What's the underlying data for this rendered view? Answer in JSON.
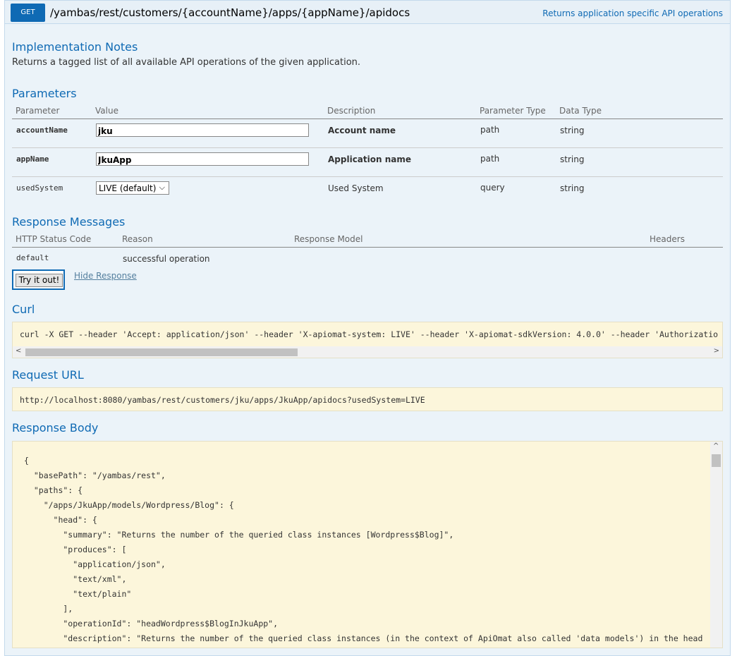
{
  "operation": {
    "method": "GET",
    "path": "/yambas/rest/customers/{accountName}/apps/{appName}/apidocs",
    "summary": "Returns application specific API operations"
  },
  "implementation": {
    "heading": "Implementation Notes",
    "text": "Returns a tagged list of all available API operations of the given application."
  },
  "parameters": {
    "heading": "Parameters",
    "columns": [
      "Parameter",
      "Value",
      "Description",
      "Parameter Type",
      "Data Type"
    ],
    "rows": [
      {
        "name": "accountName",
        "value": "jku",
        "description": "Account name",
        "type": "path",
        "data_type": "string"
      },
      {
        "name": "appName",
        "value": "JkuApp",
        "description": "Application name",
        "type": "path",
        "data_type": "string"
      },
      {
        "name": "usedSystem",
        "value": "LIVE (default)",
        "description": "Used System",
        "type": "query",
        "data_type": "string"
      }
    ]
  },
  "responses": {
    "heading": "Response Messages",
    "columns": [
      "HTTP Status Code",
      "Reason",
      "Response Model",
      "Headers"
    ],
    "rows": [
      {
        "code": "default",
        "reason": "successful operation"
      }
    ]
  },
  "actions": {
    "try_label": "Try it out!",
    "hide_label": "Hide Response"
  },
  "curl": {
    "heading": "Curl",
    "command": "curl -X GET --header 'Accept: application/json' --header 'X-apiomat-system: LIVE' --header 'X-apiomat-sdkVersion: 4.0.0' --header 'Authorizatio"
  },
  "request_url": {
    "heading": "Request URL",
    "url": "http://localhost:8080/yambas/rest/customers/jku/apps/JkuApp/apidocs?usedSystem=LIVE"
  },
  "response_body": {
    "heading": "Response Body",
    "lines": [
      "{",
      "  \"basePath\": \"/yambas/rest\",",
      "  \"paths\": {",
      "    \"/apps/JkuApp/models/Wordpress/Blog\": {",
      "      \"head\": {",
      "        \"summary\": \"Returns the number of the queried class instances [Wordpress$Blog]\",",
      "        \"produces\": [",
      "          \"application/json\",",
      "          \"text/xml\",",
      "          \"text/plain\"",
      "        ],",
      "        \"operationId\": \"headWordpress$BlogInJkuApp\",",
      "        \"description\": \"Returns the number of the queried class instances (in the context of ApiOmat also called 'data models') in the head"
    ]
  },
  "icons": {
    "chevron_down": "⌵",
    "arrow_left": "<",
    "arrow_right": ">",
    "arrow_up": "^"
  },
  "colors": {
    "accent": "#0f6ab4",
    "panel": "#ebf3f9",
    "code_bg": "#fcf6db"
  }
}
